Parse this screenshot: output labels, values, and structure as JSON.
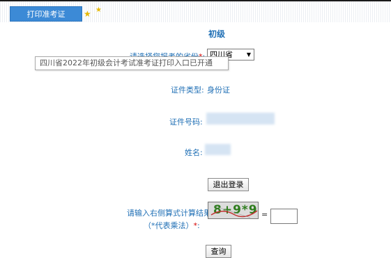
{
  "header": {
    "tab_label": "打印准考证"
  },
  "main": {
    "title": "初级",
    "province_label": "请选择您报考的省份",
    "province_value": "四川省",
    "tooltip_text": "四川省2022年初级会计考试准考证打印入口已开通",
    "cert_type_label": "证件类型:",
    "cert_type_value": "身份证",
    "cert_no_label": "证件号码:",
    "name_label": "姓名:",
    "logout_label": "退出登录",
    "captcha_label_line1": "请输入右侧算式计算结果",
    "captcha_label_line2": "（*代表乘法）",
    "captcha_text": "8+9*9",
    "equals": "=",
    "submit_label": "查询",
    "required_mark": "*",
    "colon": ":"
  },
  "colors": {
    "accent": "#3c8ad6",
    "label": "#1f6fb5",
    "required": "#d40000"
  }
}
